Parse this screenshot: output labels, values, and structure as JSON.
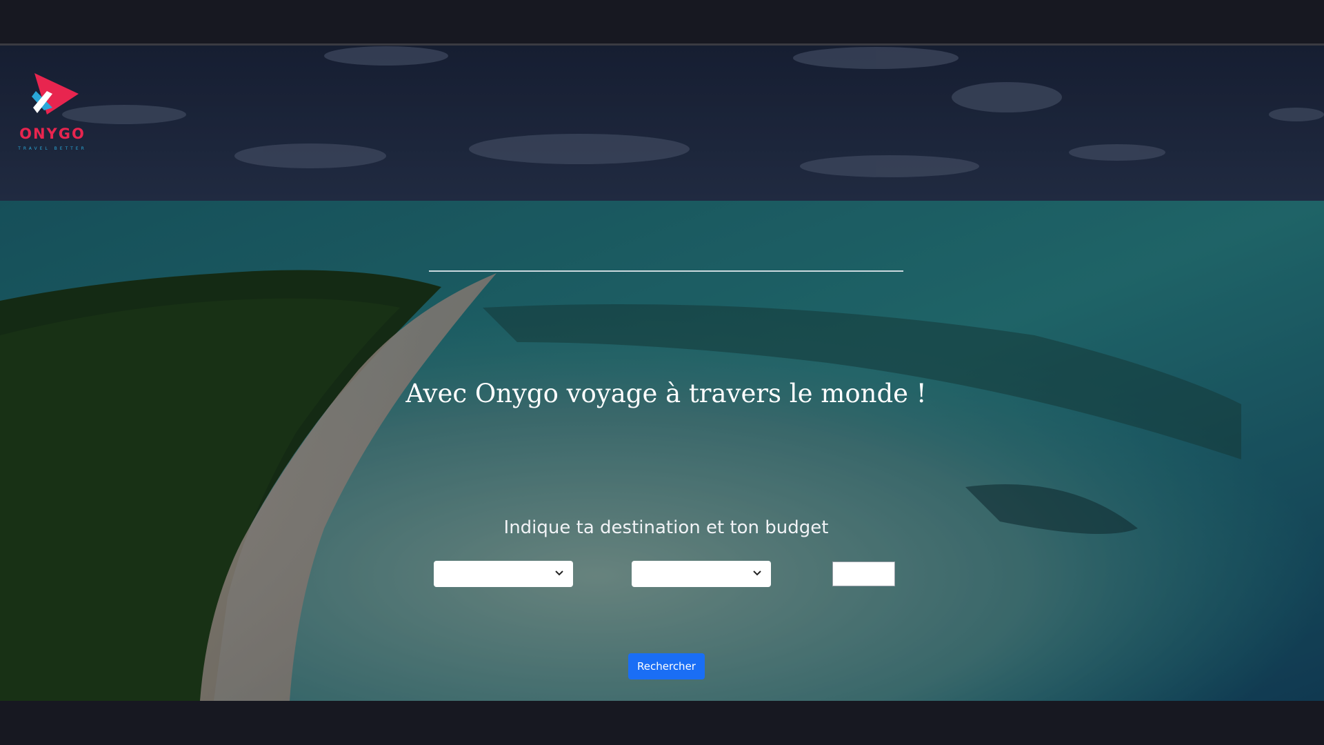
{
  "brand": {
    "name": "ONYGO",
    "tagline": "TRAVEL BETTER",
    "colors": {
      "primary": "#e8254f",
      "secondary": "#2aa7d8"
    }
  },
  "hero": {
    "headline": "Avec Onygo voyage à travers le monde !",
    "subheadline": "Indique ta destination et ton budget"
  },
  "form": {
    "destination_select": {
      "value": ""
    },
    "second_select": {
      "value": ""
    },
    "budget_input": {
      "value": ""
    },
    "search_label": "Rechercher"
  },
  "icons": {
    "logo": "onygo-logo-icon",
    "select_arrow": "chevron-down-icon"
  },
  "colors": {
    "background": "#16171f",
    "button": "#1a6ef5"
  }
}
